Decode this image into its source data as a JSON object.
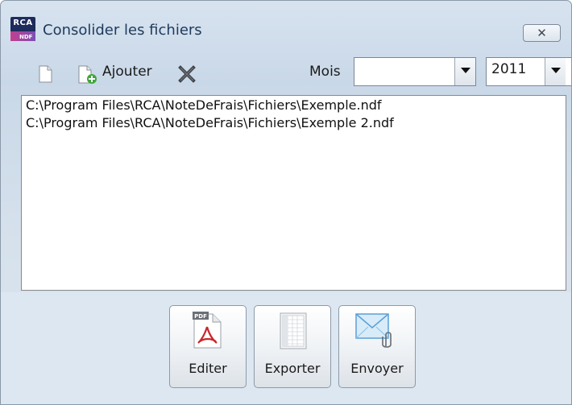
{
  "window": {
    "title": "Consolider les fichiers",
    "close_glyph": "✕"
  },
  "app_icon": {
    "text": "RCA",
    "subtext": "NDF"
  },
  "toolbar": {
    "new_icon": "new-document-icon",
    "add_label": "Ajouter",
    "delete_icon": "delete-x-icon",
    "month_label": "Mois",
    "month_value": "",
    "year_value": "2011"
  },
  "files": [
    "C:\\Program Files\\RCA\\NoteDeFrais\\Fichiers\\Exemple.ndf",
    "C:\\Program Files\\RCA\\NoteDeFrais\\Fichiers\\Exemple 2.ndf"
  ],
  "actions": {
    "edit_label": "Editer",
    "edit_icon_text": "PDF",
    "export_label": "Exporter",
    "send_label": "Envoyer"
  },
  "colors": {
    "title_text": "#1e3a5c",
    "pdf_red": "#c8262b",
    "envelope_blue": "#5aa0d8"
  }
}
